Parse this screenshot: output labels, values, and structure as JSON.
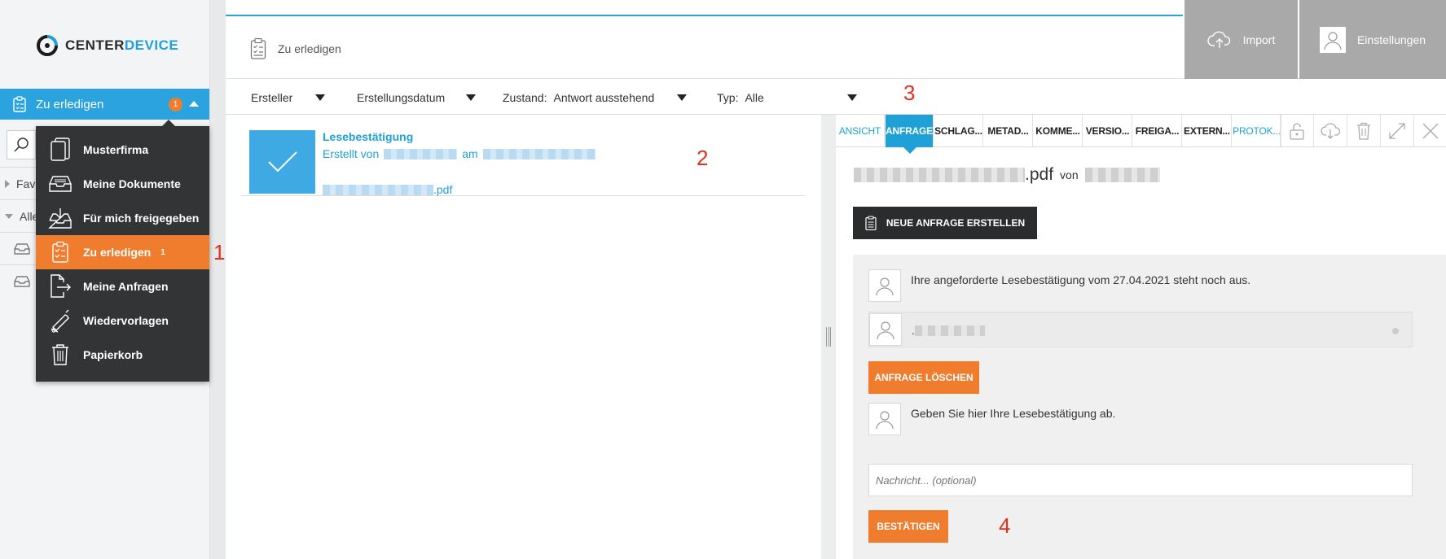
{
  "app": {
    "brand_part1": "CENTER",
    "brand_part2": "DEVICE"
  },
  "sidebar": {
    "todo_label": "Zu erledigen",
    "todo_badge": "1",
    "tree_items": [
      {
        "label": "Favo"
      },
      {
        "label": "Alle"
      }
    ]
  },
  "menu": {
    "items": [
      {
        "label": "Musterfirma",
        "icon": "documents-icon"
      },
      {
        "label": "Meine Dokumente",
        "icon": "inbox-tray-icon"
      },
      {
        "label": "Für mich freigegeben",
        "icon": "shared-inbox-icon"
      },
      {
        "label": "Zu erledigen",
        "icon": "clipboard-checklist-icon",
        "count": "1",
        "active": true
      },
      {
        "label": "Meine Anfragen",
        "icon": "document-export-icon"
      },
      {
        "label": "Wiedervorlagen",
        "icon": "bell-icon"
      },
      {
        "label": "Papierkorb",
        "icon": "trash-icon"
      }
    ]
  },
  "header": {
    "breadcrumb": "Zu erledigen",
    "import_label": "Import",
    "settings_label": "Einstellungen"
  },
  "filters": {
    "creator_label": "Ersteller",
    "date_label": "Erstellungsdatum",
    "state_label": "Zustand:",
    "state_value": "Antwort ausstehend",
    "type_label": "Typ:",
    "type_value": "Alle"
  },
  "annotations": {
    "a1": "1",
    "a2": "2",
    "a3": "3",
    "a4": "4"
  },
  "list": {
    "item": {
      "title": "Lesebestätigung",
      "created_by": "Erstellt von",
      "at": "am",
      "file_ext": ".pdf"
    }
  },
  "detail": {
    "tabs": [
      {
        "label": "ANSICHT",
        "style": "link"
      },
      {
        "label": "ANFRAGE",
        "style": "active"
      },
      {
        "label": "SCHLAG...",
        "style": "normal"
      },
      {
        "label": "METAD...",
        "style": "normal"
      },
      {
        "label": "KOMME...",
        "style": "normal"
      },
      {
        "label": "VERSIO...",
        "style": "normal"
      },
      {
        "label": "FREIGA...",
        "style": "normal"
      },
      {
        "label": "EXTERN...",
        "style": "normal"
      },
      {
        "label": "PROTOK...",
        "style": "link"
      }
    ],
    "toolbar_icons": [
      "unlock-icon",
      "cloud-download-icon",
      "trash-icon",
      "expand-icon",
      "close-icon"
    ],
    "doc_ext": ".pdf",
    "doc_von": "von",
    "new_request_label": "NEUE ANFRAGE ERSTELLEN",
    "pending_message": "Ihre angeforderte Lesebestätigung vom 27.04.2021 steht noch aus.",
    "reply_prefix": ".",
    "delete_request_label": "ANFRAGE LÖSCHEN",
    "confirm_prompt": "Geben Sie hier Ihre Lesebestätigung ab.",
    "message_placeholder": "Nachricht... (optional)",
    "confirm_label": "BESTÄTIGEN"
  },
  "colors": {
    "accent_blue": "#2aa3df",
    "accent_orange": "#f07c2d",
    "menu_dark": "#333436",
    "annotation_red": "#e0321d"
  }
}
